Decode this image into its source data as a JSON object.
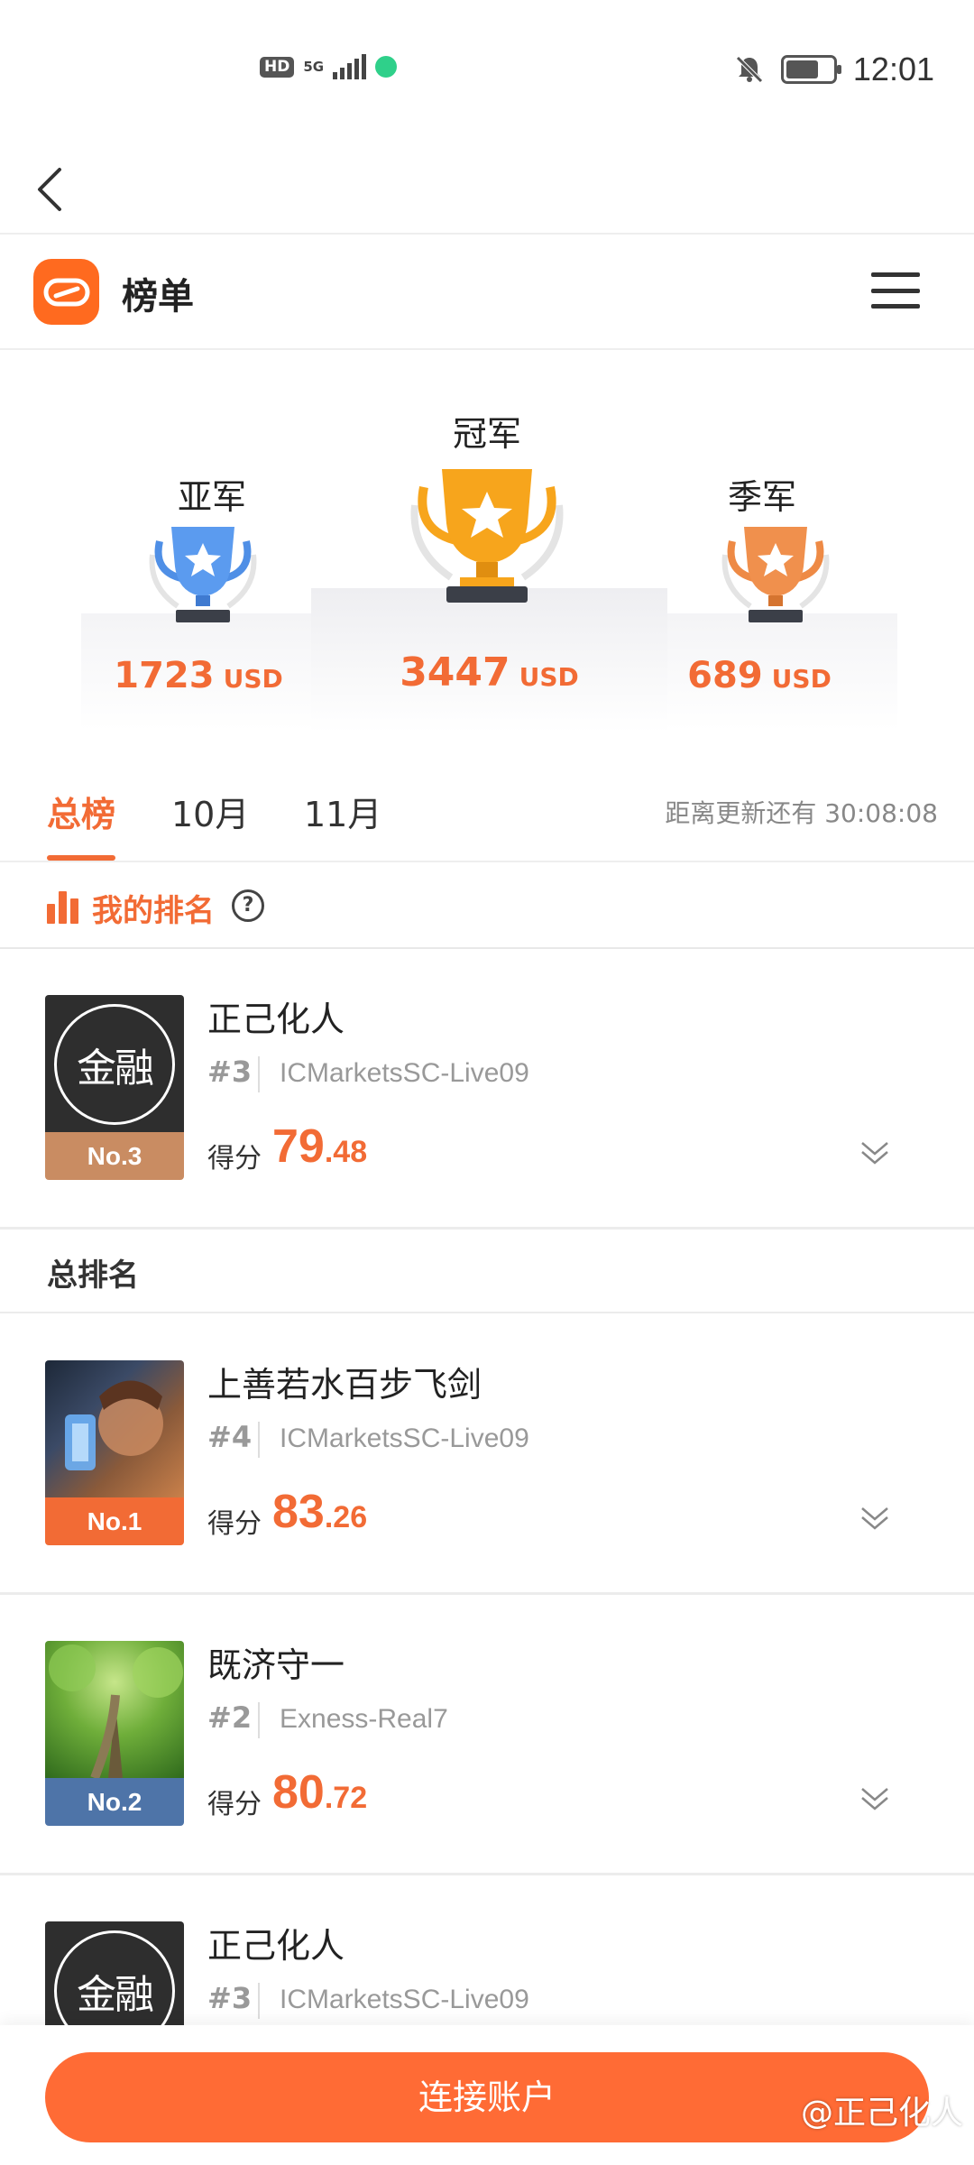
{
  "status_bar": {
    "hd": "HD",
    "network": "5G",
    "time": "12:01",
    "battery_level": 0.7
  },
  "header": {
    "title": "榜单"
  },
  "podium": {
    "champion": {
      "label": "冠军",
      "amount": "3447",
      "currency": "USD",
      "color": "#f7a51c"
    },
    "runner_up": {
      "label": "亚军",
      "amount": "1723",
      "currency": "USD",
      "color": "#4f8fe6"
    },
    "third": {
      "label": "季军",
      "amount": "689",
      "currency": "USD",
      "color": "#ee8a45"
    }
  },
  "tabs": {
    "items": [
      {
        "label": "总榜",
        "active": true
      },
      {
        "label": "10月",
        "active": false
      },
      {
        "label": "11月",
        "active": false
      }
    ],
    "countdown": "距离更新还有 30:08:08"
  },
  "my_rank": {
    "label": "我的排名",
    "help": "?",
    "entry": {
      "name": "正己化人",
      "rank": "#3",
      "server": "ICMarketsSC-Live09",
      "score_label": "得分",
      "score_int": "79",
      "score_dec": ".48",
      "badge": "No.3",
      "badge_color": "#c98c62",
      "avatar_text": "金融"
    }
  },
  "overall": {
    "title": "总排名",
    "entries": [
      {
        "name": "上善若水百步飞剑",
        "rank": "#4",
        "server": "ICMarketsSC-Live09",
        "score_label": "得分",
        "score_int": "83",
        "score_dec": ".26",
        "badge": "No.1",
        "badge_color": "#f26b35"
      },
      {
        "name": "既济守一",
        "rank": "#2",
        "server": "Exness-Real7",
        "score_label": "得分",
        "score_int": "80",
        "score_dec": ".72",
        "badge": "No.2",
        "badge_color": "#4e74a8"
      },
      {
        "name": "正己化人",
        "rank": "#3",
        "server": "ICMarketsSC-Live09",
        "avatar_text": "金融"
      }
    ]
  },
  "bottom": {
    "connect_label": "连接账户",
    "watermark": "@正己化人"
  },
  "colors": {
    "accent": "#f26b35",
    "button": "#ff6b35"
  }
}
